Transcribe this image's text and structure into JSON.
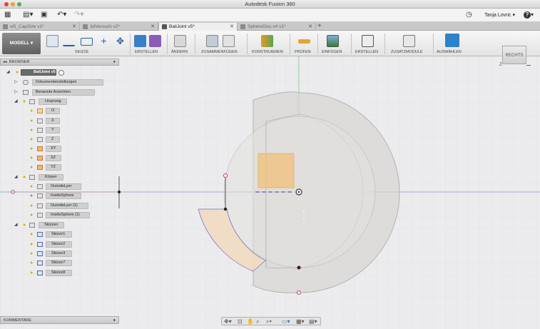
{
  "window": {
    "title": "Autodesk Fusion 360"
  },
  "user": {
    "name": "Tanja Lovric",
    "help": "?"
  },
  "tabs": [
    {
      "label": "w5_CapSize v1*",
      "active": false
    },
    {
      "label": "3dVersuch v2*",
      "active": false
    },
    {
      "label": "BallJoint v5*",
      "active": true
    },
    {
      "label": "SphereDisc v4 v1*",
      "active": false
    }
  ],
  "ribbon": {
    "workspace": "MODELL",
    "groups": [
      {
        "label": "SKIZZE"
      },
      {
        "label": "ERSTELLEN"
      },
      {
        "label": "ÄNDERN"
      },
      {
        "label": "ZUSAMMENFÜGEN"
      },
      {
        "label": "KONSTRUIEREN"
      },
      {
        "label": "PRÜFEN"
      },
      {
        "label": "EINFÜGEN"
      },
      {
        "label": "ERSTELLEN"
      },
      {
        "label": "ZUSATZMODULE"
      },
      {
        "label": "AUSWÄHLEN"
      }
    ],
    "colors": {
      "accent": "#2c83c9",
      "highlight": "#e59a2a"
    }
  },
  "browser": {
    "title": "BROWSER",
    "root": "BallJoint v5",
    "items": [
      {
        "label": "Dokumenteinstellungen"
      },
      {
        "label": "Benannte Ansichten"
      },
      {
        "label": "Ursprung"
      },
      {
        "label": "O"
      },
      {
        "label": "X"
      },
      {
        "label": "Y"
      },
      {
        "label": "Z"
      },
      {
        "label": "XY"
      },
      {
        "label": "XZ"
      },
      {
        "label": "YZ"
      },
      {
        "label": "Körper"
      },
      {
        "label": "OutsideLyer"
      },
      {
        "label": "InsideSphere"
      },
      {
        "label": "OutsideLyer (1)"
      },
      {
        "label": "InsideSphere (1)"
      },
      {
        "label": "Skizzen"
      },
      {
        "label": "Skizze1"
      },
      {
        "label": "Skizze2"
      },
      {
        "label": "Skizze3"
      },
      {
        "label": "Skizze7"
      },
      {
        "label": "Skizze8"
      }
    ]
  },
  "comments": {
    "title": "KOMMENTARE"
  },
  "viewcube": {
    "label": "RECHTS"
  }
}
